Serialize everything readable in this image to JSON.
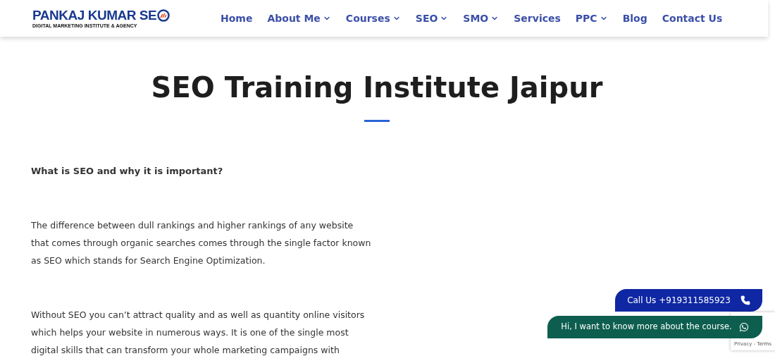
{
  "logo": {
    "name": "PANKAJ KUMAR SE",
    "tagline": "DIGITAL MARKETING INSTITUTE & AGENCY"
  },
  "nav": [
    {
      "label": "Home",
      "has_dropdown": false
    },
    {
      "label": "About Me",
      "has_dropdown": true
    },
    {
      "label": "Courses",
      "has_dropdown": true
    },
    {
      "label": "SEO",
      "has_dropdown": true
    },
    {
      "label": "SMO",
      "has_dropdown": true
    },
    {
      "label": "Services",
      "has_dropdown": false
    },
    {
      "label": "PPC",
      "has_dropdown": true
    },
    {
      "label": "Blog",
      "has_dropdown": false
    },
    {
      "label": "Contact Us",
      "has_dropdown": false
    }
  ],
  "page_title": "SEO Training Institute Jaipur",
  "content": [
    {
      "kind": "heading",
      "text": "What is SEO and why it is important?"
    },
    {
      "kind": "paragraph",
      "text": "The difference between dull rankings and higher rankings of any website that comes through organic searches comes through the single factor known as SEO which stands for Search Engine Optimization."
    },
    {
      "kind": "paragraph",
      "text": "Without SEO you can’t attract quality and as well as quantity online visitors which helps your website in numerous ways. It is one of the single most digital skills that can transform your whole marketing campaigns with"
    }
  ],
  "call_button": "Call Us +919311585923",
  "whatsapp_button": "Hi, I want to know more about the course.",
  "recaptcha": "Privacy - Terms"
}
